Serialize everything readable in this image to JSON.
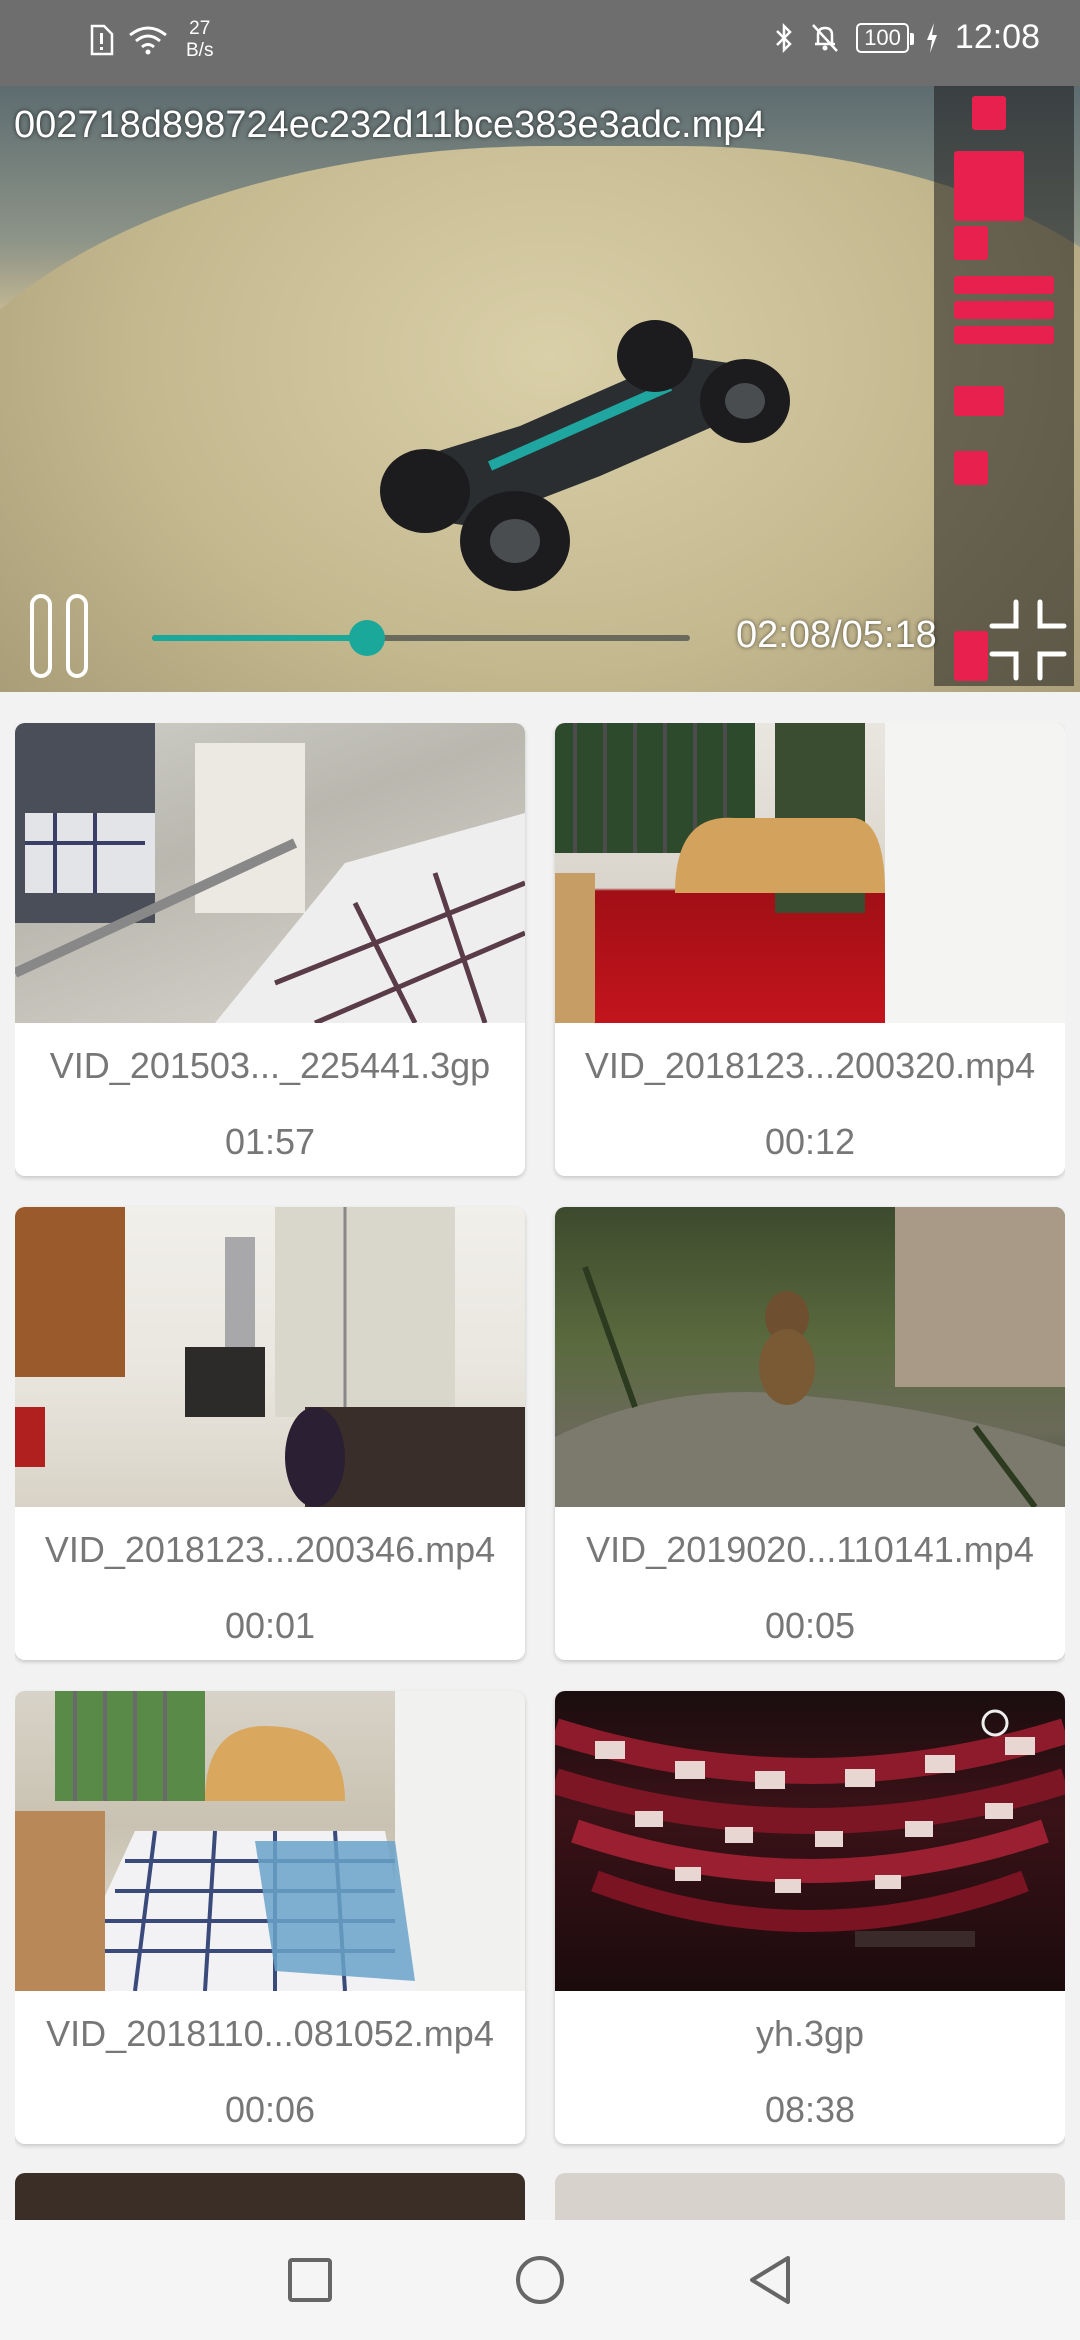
{
  "status_bar": {
    "net_speed_value": "27",
    "net_speed_unit": "B/s",
    "battery": "100",
    "time": "12:08"
  },
  "player": {
    "title": "002718d898724ec232d11bce383e3adc.mp4",
    "position": "02:08",
    "duration": "05:18",
    "time_display": "02:08/05:18",
    "progress_fraction": 0.4,
    "accent_color": "#1aa89a"
  },
  "videos": [
    {
      "name": "VID_201503..._225441.3gp",
      "duration": "01:57"
    },
    {
      "name": "VID_2018123...200320.mp4",
      "duration": "00:12"
    },
    {
      "name": "VID_2018123...200346.mp4",
      "duration": "00:01"
    },
    {
      "name": "VID_2019020...110141.mp4",
      "duration": "00:05"
    },
    {
      "name": "VID_2018110...081052.mp4",
      "duration": "00:06"
    },
    {
      "name": "yh.3gp",
      "duration": "08:38"
    }
  ],
  "nav": {
    "icons": [
      "recents-square-icon",
      "home-circle-icon",
      "back-triangle-icon"
    ]
  }
}
